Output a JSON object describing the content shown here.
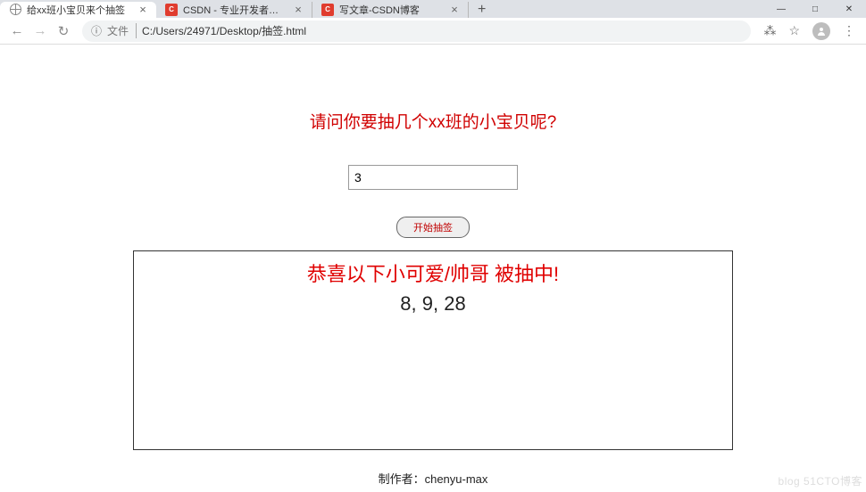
{
  "browser": {
    "tabs": [
      {
        "title": "给xx班小宝贝来个抽签",
        "favicon": "globe"
      },
      {
        "title": "CSDN - 专业开发者社区",
        "favicon": "csdn"
      },
      {
        "title": "写文章-CSDN博客",
        "favicon": "csdn"
      }
    ],
    "new_tab": "+",
    "window": {
      "min": "—",
      "max": "□",
      "close": "✕"
    },
    "nav": {
      "back": "←",
      "forward": "→",
      "reload": "↻"
    },
    "url_prefix_icon": "ⓘ",
    "url_file_label": "文件",
    "url": "C:/Users/24971/Desktop/抽签.html",
    "translate": "⁂",
    "star": "☆",
    "menu": "⋮"
  },
  "page": {
    "prompt": "请问你要抽几个xx班的小宝贝呢?",
    "input_value": "3",
    "start_button": "开始抽签",
    "result_title": "恭喜以下小可爱/帅哥 被抽中!",
    "result_numbers": "8, 9, 28",
    "footer": "制作者：chenyu-max"
  },
  "watermark": "blog 51CTO博客"
}
